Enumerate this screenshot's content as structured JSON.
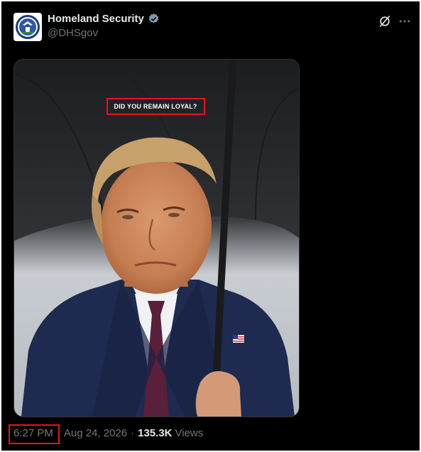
{
  "post": {
    "author": {
      "display_name": "Homeland Security",
      "handle": "@DHSgov",
      "verified_icon": "verified-badge-icon",
      "avatar_icon": "dhs-seal-icon"
    },
    "actions": {
      "grok_icon": "grok-icon",
      "more_icon": "more-options-icon"
    },
    "media": {
      "overlay_text": "DID YOU REMAIN LOYAL?"
    },
    "meta": {
      "time": "6:27 PM",
      "separator": "·",
      "date": "Aug 24, 2026",
      "views_count": "135.3K",
      "views_label": "Views"
    }
  },
  "colors": {
    "background": "#000000",
    "text_primary": "#e7e9ea",
    "text_secondary": "#71767b",
    "verified": "#829aab",
    "highlight": "#e3161b"
  }
}
